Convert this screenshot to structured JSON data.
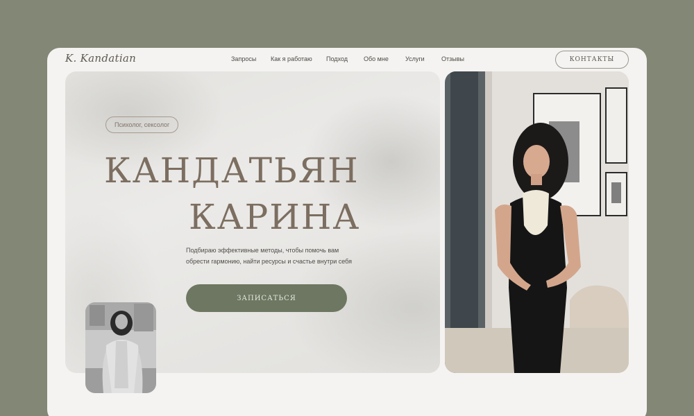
{
  "header": {
    "logo": "K. Kandatian",
    "nav": [
      {
        "label": "Запросы"
      },
      {
        "label": "Как я работаю"
      },
      {
        "label": "Подход"
      },
      {
        "label": "Обо мне"
      },
      {
        "label": "Услуги"
      },
      {
        "label": "Отзывы"
      }
    ],
    "contacts_label": "КОНТАКТЫ"
  },
  "hero": {
    "badge": "Психолог, сексолог",
    "name_line1": "КАНДАТЬЯН",
    "name_line2": "КАРИНА",
    "description_line1": "Подбираю эффективные методы, чтобы помочь вам",
    "description_line2": "обрести гармонию, найти ресурсы и счастье внутри себя",
    "cta_label": "ЗАПИСАТЬСЯ"
  },
  "colors": {
    "page_bg": "#838776",
    "site_bg": "#f4f3f1",
    "accent_green": "#6d7761",
    "title_brown": "#7c6e60"
  }
}
